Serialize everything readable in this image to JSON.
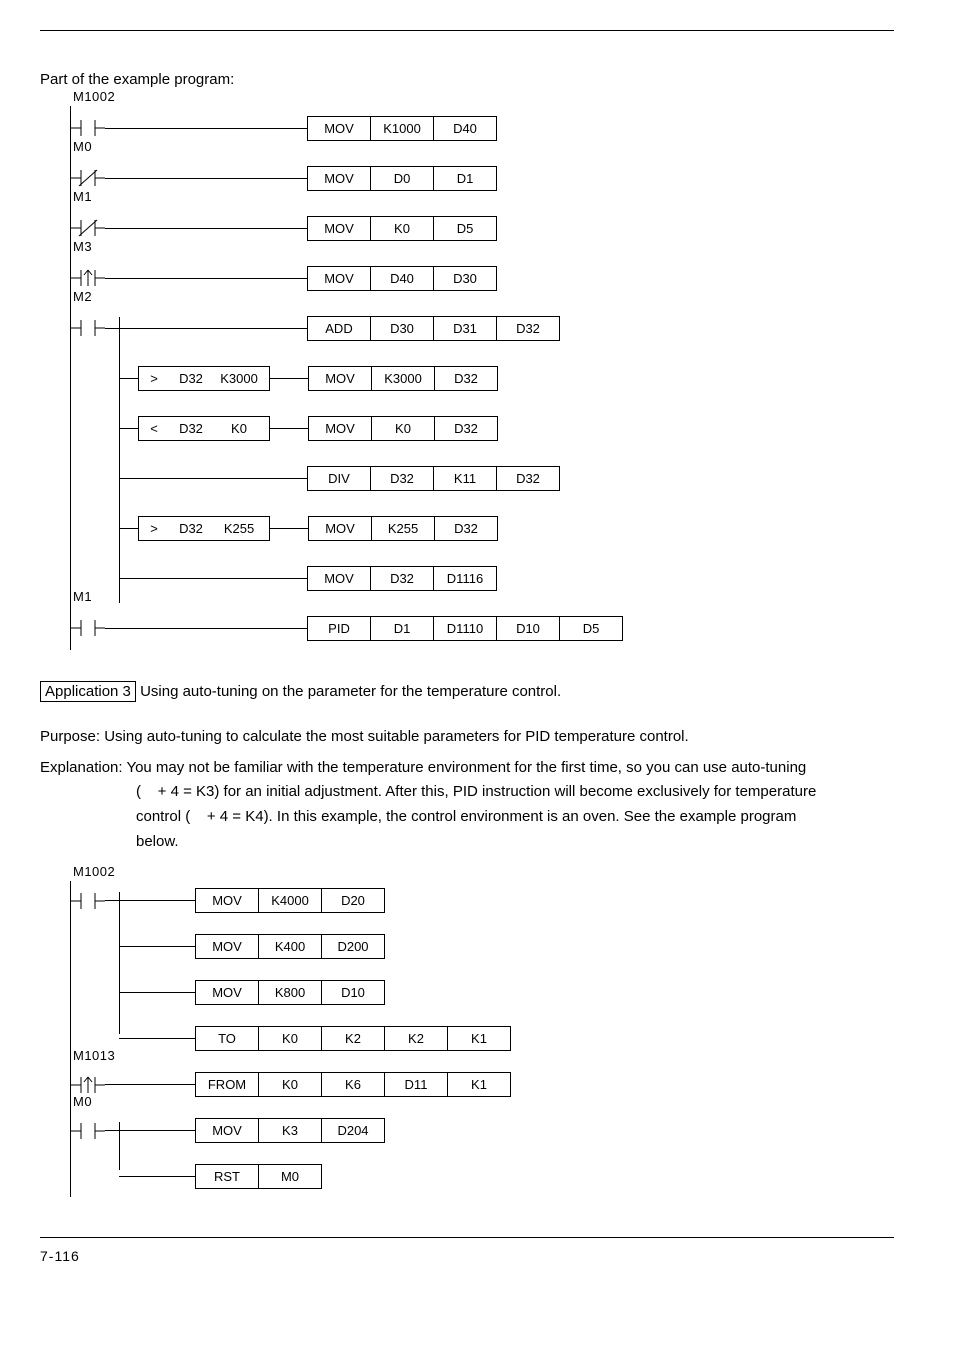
{
  "intro": "Part of the example program:",
  "ladder1": {
    "contacts": {
      "c0": "M1002",
      "c1": "M0",
      "c2": "M1",
      "c3": "M3",
      "c4": "M2",
      "c5": "M1"
    },
    "rows": [
      {
        "op": "MOV",
        "a": "K1000",
        "b": "D40"
      },
      {
        "op": "MOV",
        "a": "D0",
        "b": "D1"
      },
      {
        "op": "MOV",
        "a": "K0",
        "b": "D5"
      },
      {
        "op": "MOV",
        "a": "D40",
        "b": "D30"
      },
      {
        "op": "ADD",
        "a": "D30",
        "b": "D31",
        "c": "D32"
      },
      {
        "op": "MOV",
        "a": "K3000",
        "b": "D32"
      },
      {
        "op": "MOV",
        "a": "K0",
        "b": "D32"
      },
      {
        "op": "DIV",
        "a": "D32",
        "b": "K11",
        "c": "D32"
      },
      {
        "op": "MOV",
        "a": "K255",
        "b": "D32"
      },
      {
        "op": "MOV",
        "a": "D32",
        "b": "D1116"
      },
      {
        "op": "PID",
        "a": "D1",
        "b": "D1110",
        "c": "D10",
        "d": "D5"
      }
    ],
    "compares": [
      {
        "op": ">",
        "a": "D32",
        "b": "K3000"
      },
      {
        "op": "<",
        "a": "D32",
        "b": "K0"
      },
      {
        "op": ">",
        "a": "D32",
        "b": "K255"
      }
    ]
  },
  "app3": {
    "box": "Application 3",
    "after": " Using auto-tuning on the parameter for the temperature control."
  },
  "purpose": "Purpose: Using auto-tuning to calculate the most suitable parameters for PID temperature control.",
  "explain_head": "Explanation: You may not be familiar with the temperature environment for the first time, so you can use auto-tuning",
  "explain_body1": "(    + 4 = K3) for an initial adjustment. After this, PID instruction will become exclusively for temperature",
  "explain_body2": "control (    + 4 = K4). In this example, the control environment is an oven. See the example program",
  "explain_body3": "below.",
  "ladder2": {
    "contacts": {
      "c0": "M1002",
      "c1": "M1013",
      "c2": "M0"
    },
    "rows": [
      {
        "op": "MOV",
        "a": "K4000",
        "b": "D20"
      },
      {
        "op": "MOV",
        "a": "K400",
        "b": "D200"
      },
      {
        "op": "MOV",
        "a": "K800",
        "b": "D10"
      },
      {
        "op": "TO",
        "a": "K0",
        "b": "K2",
        "c": "K2",
        "d": "K1"
      },
      {
        "op": "FROM",
        "a": "K0",
        "b": "K6",
        "c": "D11",
        "d": "K1"
      },
      {
        "op": "MOV",
        "a": "K3",
        "b": "D204"
      },
      {
        "op": "RST",
        "a": "M0"
      }
    ]
  },
  "page_num": "7-116"
}
